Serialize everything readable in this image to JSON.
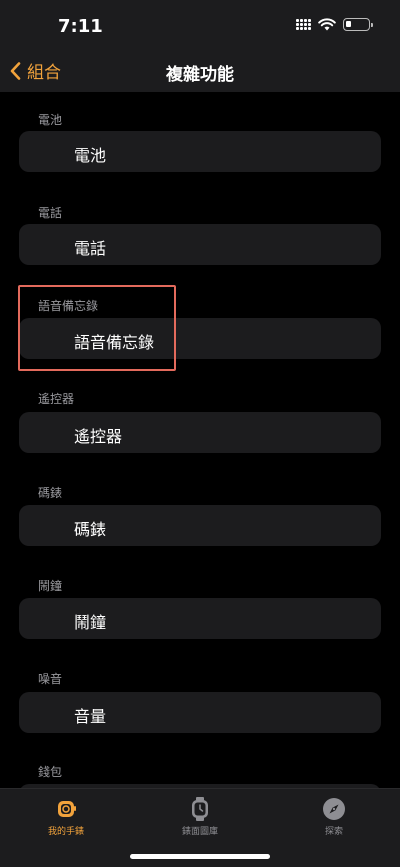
{
  "status_bar": {
    "time": "7:11"
  },
  "nav": {
    "back_label": "組合",
    "title": "複雜功能"
  },
  "sections": [
    {
      "header": "電池",
      "value": "電池"
    },
    {
      "header": "電話",
      "value": "電話"
    },
    {
      "header": "語音備忘錄",
      "value": "語音備忘錄"
    },
    {
      "header": "遙控器",
      "value": "遙控器"
    },
    {
      "header": "碼錶",
      "value": "碼錶"
    },
    {
      "header": "鬧鐘",
      "value": "鬧鐘"
    },
    {
      "header": "噪音",
      "value": "音量"
    },
    {
      "header": "錢包",
      "value": ""
    }
  ],
  "tabs": [
    {
      "label": "我的手錶",
      "icon": "watch-icon",
      "active": true
    },
    {
      "label": "錶面圖庫",
      "icon": "watch-face-icon",
      "active": false
    },
    {
      "label": "探索",
      "icon": "compass-icon",
      "active": false
    }
  ],
  "colors": {
    "accent": "#f2a33c",
    "highlight": "#e36a5c",
    "cell": "#1c1c1e",
    "background": "#000000"
  }
}
